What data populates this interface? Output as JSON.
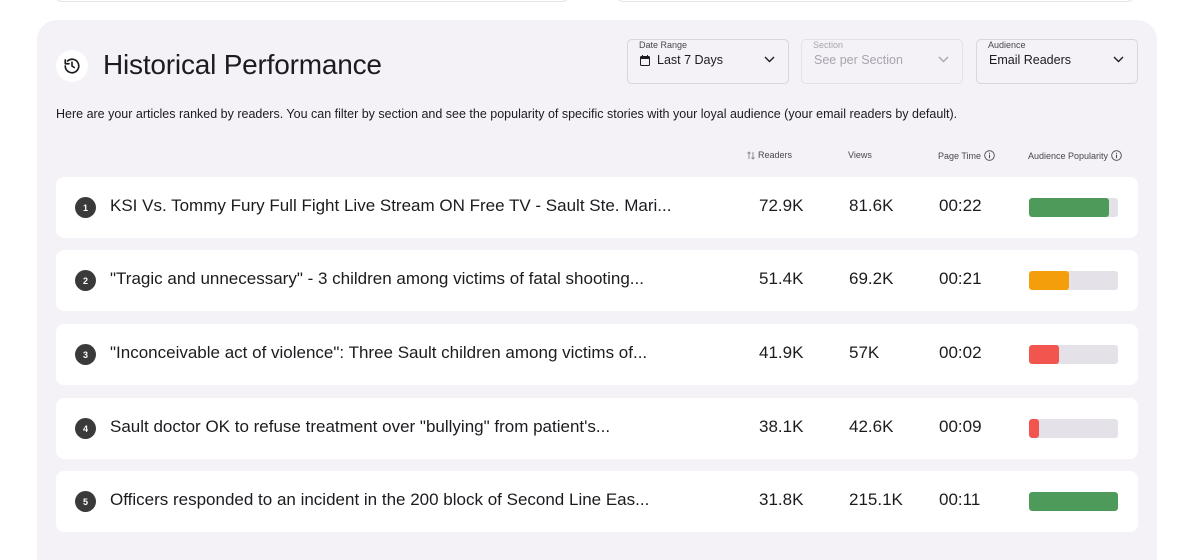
{
  "panel": {
    "title": "Historical Performance",
    "description": "Here are your articles ranked by readers. You can filter by section and see the popularity of specific stories with your loyal audience (your email readers by default)."
  },
  "filters": {
    "date_range": {
      "label": "Date Range",
      "value": "Last 7 Days"
    },
    "section": {
      "label": "Section",
      "placeholder": "See per Section"
    },
    "audience": {
      "label": "Audience",
      "value": "Email Readers"
    }
  },
  "columns": {
    "readers": "Readers",
    "views": "Views",
    "page_time": "Page Time",
    "audience_popularity": "Audience Popularity"
  },
  "articles": [
    {
      "rank": "1",
      "title": "KSI Vs. Tommy Fury Full Fight Live Stream ON Free TV - Sault Ste. Mari...",
      "readers": "72.9K",
      "views": "81.6K",
      "page_time": "00:22",
      "popularity": 0.9,
      "color": "#4e9a5a"
    },
    {
      "rank": "2",
      "title": "\"Tragic and unnecessary\" - 3 children among victims of fatal shooting...",
      "readers": "51.4K",
      "views": "69.2K",
      "page_time": "00:21",
      "popularity": 0.45,
      "color": "#f59e0b"
    },
    {
      "rank": "3",
      "title": "\"Inconceivable act of violence\": Three Sault children among victims of...",
      "readers": "41.9K",
      "views": "57K",
      "page_time": "00:02",
      "popularity": 0.34,
      "color": "#f2554d"
    },
    {
      "rank": "4",
      "title": "Sault doctor OK to refuse treatment over \"bullying\" from patient's...",
      "readers": "38.1K",
      "views": "42.6K",
      "page_time": "00:09",
      "popularity": 0.11,
      "color": "#f2554d"
    },
    {
      "rank": "5",
      "title": "Officers responded to an incident in the 200 block of Second Line Eas...",
      "readers": "31.8K",
      "views": "215.1K",
      "page_time": "00:11",
      "popularity": 1.0,
      "color": "#4e9a5a"
    }
  ]
}
